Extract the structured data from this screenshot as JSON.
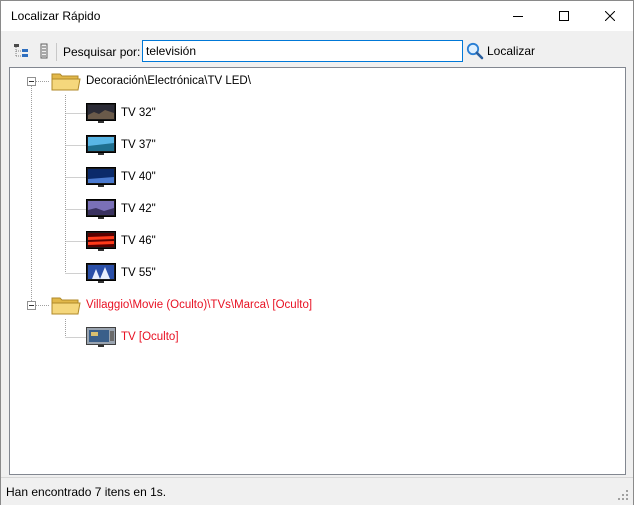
{
  "window": {
    "title": "Localizar Rápido"
  },
  "toolbar": {
    "search_label": "Pesquisar por:",
    "search_value": "televisión",
    "find_label": "Localizar"
  },
  "tree": {
    "groups": [
      {
        "label": "Decoración\\Electrónica\\TV LED\\",
        "hidden": false,
        "items": [
          {
            "label": "TV 32\"",
            "thumb": "dark-city"
          },
          {
            "label": "TV 37\"",
            "thumb": "blue-sea"
          },
          {
            "label": "TV 40\"",
            "thumb": "night-blue"
          },
          {
            "label": "TV 42\"",
            "thumb": "purple-sky"
          },
          {
            "label": "TV 46\"",
            "thumb": "red-lines"
          },
          {
            "label": "TV 55\"",
            "thumb": "blue-white"
          }
        ]
      },
      {
        "label": "Villaggio\\Movie (Oculto)\\TVs\\Marca\\ [Oculto]",
        "hidden": true,
        "items": [
          {
            "label": "TV [Oculto]",
            "thumb": "tv-set"
          }
        ]
      }
    ]
  },
  "status": {
    "text": "Han encontrado 7 itens en 1s."
  },
  "colors": {
    "hidden_text": "#e81123",
    "accent": "#0078d7"
  }
}
